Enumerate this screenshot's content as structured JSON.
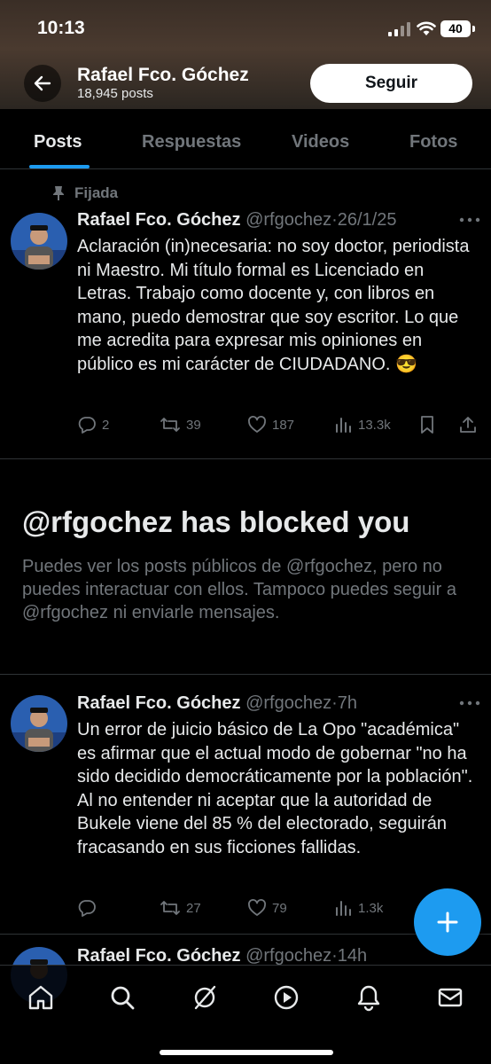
{
  "status_bar": {
    "time": "10:13",
    "battery": "40"
  },
  "profile": {
    "name": "Rafael Fco. Góchez",
    "posts_count": "18,945 posts",
    "follow_label": "Seguir"
  },
  "tabs": [
    {
      "label": "Posts",
      "active": true
    },
    {
      "label": "Respuestas",
      "active": false
    },
    {
      "label": "Videos",
      "active": false
    },
    {
      "label": "Fotos",
      "active": false
    }
  ],
  "pinned_label": "Fijada",
  "tweets": [
    {
      "name": "Rafael Fco. Góchez",
      "handle": "@rfgochez",
      "time": "26/1/25",
      "text": "Aclaración (in)necesaria: no soy doctor, periodista ni Maestro. Mi título formal es Licenciado en Letras. Trabajo como docente y, con libros en mano, puedo demostrar que soy escritor. Lo que me acredita para expresar mis opiniones en público es mi carácter de CIUDADANO. 😎",
      "replies": "2",
      "reposts": "39",
      "likes": "187",
      "views": "13.3k"
    },
    {
      "name": "Rafael Fco. Góchez",
      "handle": "@rfgochez",
      "time": "7h",
      "text": "Un error de juicio básico de La Opo \"académica\" es afirmar que el actual modo de gobernar \"no ha sido decidido democráticamente por la población\". Al no entender ni aceptar que la autoridad de Bukele viene del 85 % del electorado, seguirán fracasando en sus ficciones fallidas.",
      "replies": "",
      "reposts": "27",
      "likes": "79",
      "views": "1.3k"
    },
    {
      "name": "Rafael Fco. Góchez",
      "handle": "@rfgochez",
      "time": "14h"
    }
  ],
  "blocked": {
    "title": "@rfgochez has blocked you",
    "description": "Puedes ver los posts públicos de @rfgochez, pero no puedes interactuar con ellos. Tampoco puedes seguir a @rfgochez ni enviarle mensajes."
  },
  "colors": {
    "accent": "#1d9bf0",
    "muted": "#71767b",
    "background": "#000000"
  },
  "icons": [
    "back-arrow-icon",
    "pin-icon",
    "more-icon",
    "reply-icon",
    "repost-icon",
    "like-icon",
    "views-icon",
    "bookmark-icon",
    "share-icon",
    "plus-icon",
    "home-icon",
    "search-icon",
    "grok-icon",
    "video-icon",
    "bell-icon",
    "mail-icon"
  ]
}
